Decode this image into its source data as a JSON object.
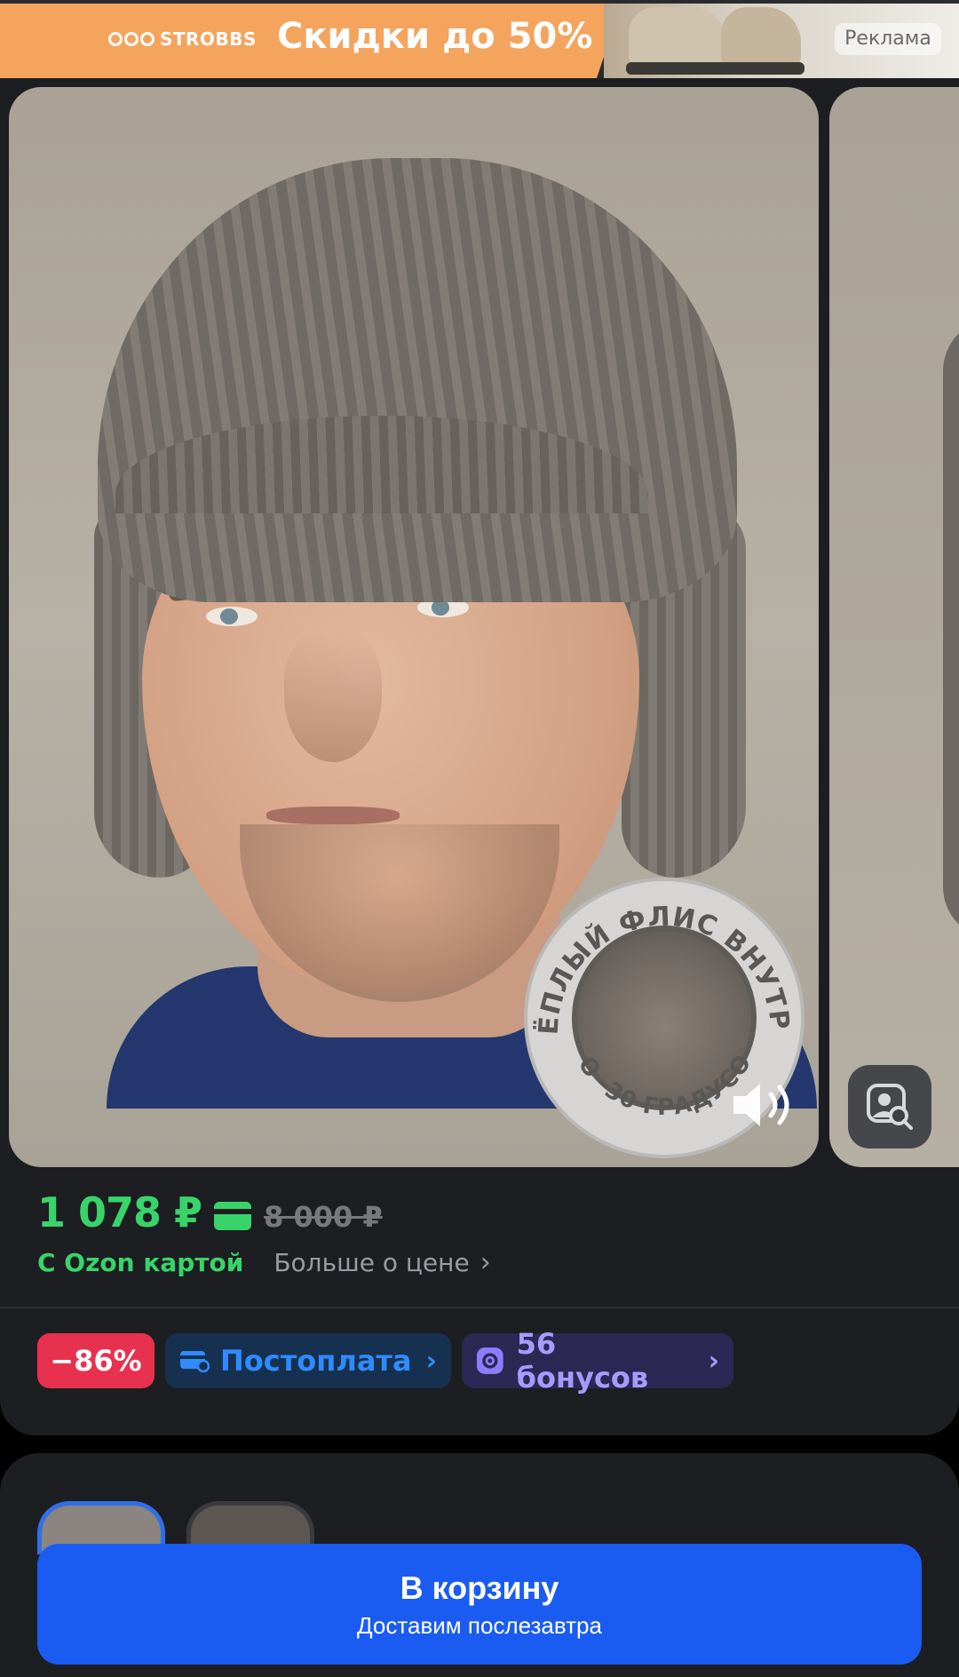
{
  "ad": {
    "brand": "STROBBS",
    "headline": "Скидки до 50%",
    "label": "Реклама"
  },
  "product_image": {
    "badge_text_top": "ТЁПЛЫЙ ФЛИС ВНУТРИ",
    "badge_text_bottom": "ДО -30 ГРАДУСОВ"
  },
  "price": {
    "current": "1 078 ₽",
    "old": "8 000 ₽",
    "ozon_card_label": "С Ozon картой",
    "more_link": "Больше о цене"
  },
  "pills": {
    "discount": "−86%",
    "postpay": "Постоплата",
    "bonus": "56 бонусов"
  },
  "cart": {
    "title": "В корзину",
    "subtitle": "Доставим послезавтра"
  },
  "colors": {
    "accent_green": "#38d46a",
    "accent_blue": "#1a5cf2",
    "discount_red": "#e8314f",
    "background": "#1d1e21"
  }
}
